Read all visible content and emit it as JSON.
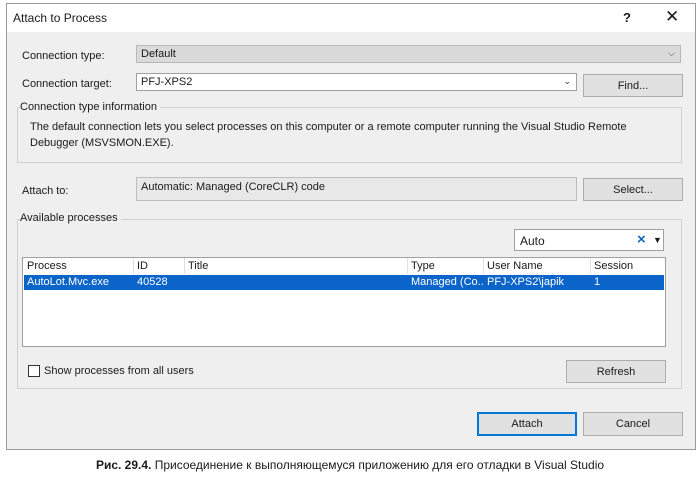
{
  "window": {
    "title": "Attach to Process",
    "help_glyph": "?",
    "close_glyph": "✕"
  },
  "connection": {
    "type_label": "Connection type:",
    "type_value": "Default",
    "target_label": "Connection target:",
    "target_value": "PFJ-XPS2",
    "find_label": "Find..."
  },
  "info": {
    "title": "Connection type information",
    "text": "The default connection lets you select processes on this computer or a remote computer running the Visual Studio Remote Debugger (MSVSMON.EXE)."
  },
  "attach_to": {
    "label": "Attach to:",
    "value": "Automatic: Managed (CoreCLR) code",
    "select_label": "Select..."
  },
  "processes": {
    "title": "Available processes",
    "filter_value": "Auto",
    "columns": [
      "Process",
      "ID",
      "Title",
      "Type",
      "User Name",
      "Session"
    ],
    "rows": [
      {
        "process": "AutoLot.Mvc.exe",
        "id": "40528",
        "title": "",
        "type": "Managed (Co...",
        "user": "PFJ-XPS2\\japik",
        "session": "1"
      }
    ],
    "show_all_label": "Show processes from all users",
    "refresh_label": "Refresh"
  },
  "footer": {
    "attach_label": "Attach",
    "cancel_label": "Cancel"
  },
  "caption": {
    "prefix": "Рис. 29.4.",
    "text": " Присоединение к выполняющемуся приложению для его отладки в Visual Studio"
  },
  "colors": {
    "selection": "#0a64c9",
    "primary_border": "#0078d7",
    "clear_icon": "#1566c0"
  }
}
